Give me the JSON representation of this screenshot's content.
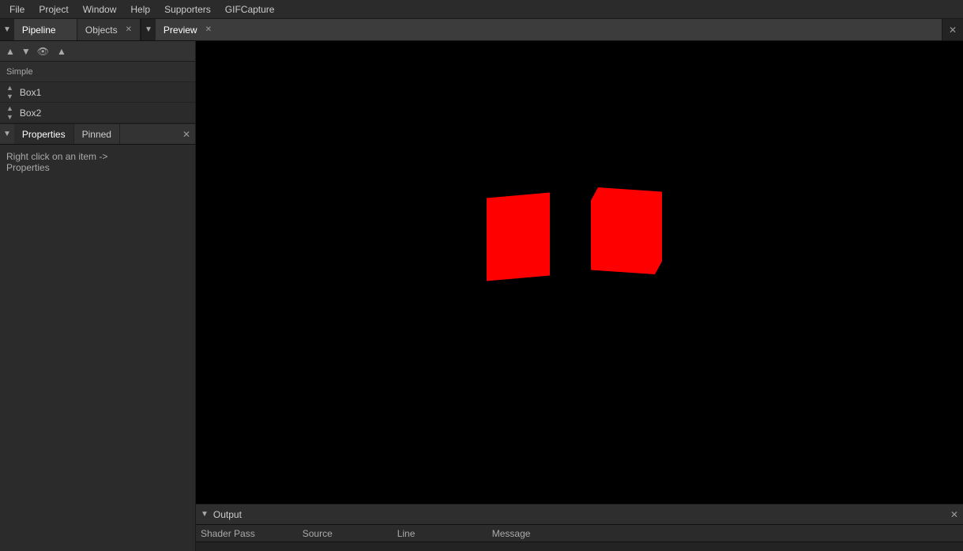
{
  "menubar": {
    "items": [
      "File",
      "Project",
      "Window",
      "Help",
      "Supporters",
      "GIFCapture"
    ]
  },
  "top_tabs": {
    "pipeline_tab": {
      "label": "Pipeline",
      "pinned": true
    },
    "objects_tab": {
      "label": "Objects",
      "active": true,
      "closable": true
    },
    "preview_tab": {
      "label": "Preview",
      "active": true,
      "closable": true,
      "pinned": true
    }
  },
  "objects_toolbar": {
    "buttons": [
      "▲",
      "▼",
      "👁",
      "▲"
    ]
  },
  "objects_list": {
    "group_label": "Simple",
    "items": [
      {
        "name": "Box1"
      },
      {
        "name": "Box2"
      }
    ]
  },
  "properties_panel": {
    "tabs": [
      "Properties",
      "Pinned"
    ],
    "active_tab": "Properties",
    "hint_line1": "Right click on an item ->",
    "hint_line2": "Properties"
  },
  "output_panel": {
    "title": "Output",
    "columns": [
      "Shader Pass",
      "Source",
      "Line",
      "Message"
    ]
  },
  "preview": {
    "close_label": "✕"
  }
}
